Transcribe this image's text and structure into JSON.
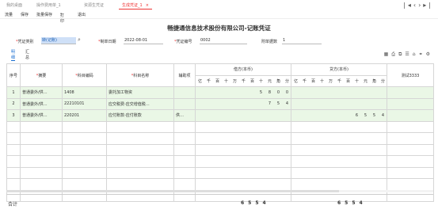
{
  "tabs": [
    {
      "label": "我的桌面"
    },
    {
      "label": "操作费用单_1"
    },
    {
      "label": "资源生凭证"
    },
    {
      "label": "生成凭证_1",
      "active": true
    }
  ],
  "toolbar": {
    "items": [
      "流量",
      "保存",
      "批量保存",
      "打印",
      "退出"
    ]
  },
  "company_title": "畅捷通信息技术股份有限公司-记账凭证",
  "header": {
    "voucher_type_label": "凭证类别",
    "voucher_type_value": "转(记账)",
    "date_label": "制单日期",
    "date_value": "2022-08-01",
    "number_label": "凭证编号",
    "number_value": "0002",
    "attachments_label": "附单据数",
    "attachments_value": "1"
  },
  "subtabs": [
    "明细",
    "汇总"
  ],
  "table": {
    "headers": {
      "index": "序号",
      "summary": "摘要",
      "account_code": "科目编码",
      "account_name": "科目名称",
      "aux": "辅助项",
      "debit": "借方(本币)",
      "credit": "贷方(本币)",
      "extra": "测试3333"
    },
    "digit_labels": [
      "亿",
      "千",
      "百",
      "十",
      "万",
      "千",
      "百",
      "十",
      "元",
      "角",
      "分"
    ],
    "rows": [
      {
        "index": "1",
        "summary": "普通委外/供…",
        "code": "1408",
        "name": "委托加工物资",
        "aux": "",
        "debit": "5800",
        "credit": ""
      },
      {
        "index": "2",
        "summary": "普通委外/供…",
        "code": "22210101",
        "name": "应交税费-应交增值税…",
        "aux": "",
        "debit": "754",
        "credit": ""
      },
      {
        "index": "3",
        "summary": "普通委外/供…",
        "code": "220201",
        "name": "应付账款-应付账款",
        "aux": "供…",
        "debit": "",
        "credit": "6554"
      }
    ]
  },
  "totals": {
    "label": "合计",
    "debit": "6554",
    "credit": "6554"
  }
}
